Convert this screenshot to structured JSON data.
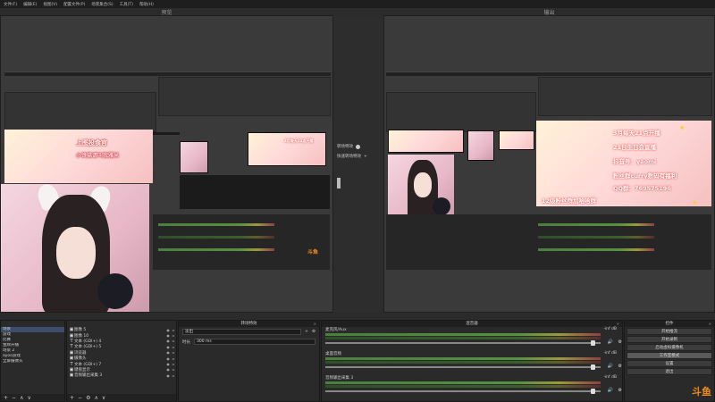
{
  "menu": [
    "文件(F)",
    "编辑(E)",
    "视图(V)",
    "配置文件(P)",
    "场景集合(S)",
    "工具(T)",
    "帮助(H)"
  ],
  "preview_title": "预览",
  "program_title": "输出",
  "transition": {
    "label1": "转场特效",
    "label2": "快速转场特效"
  },
  "overlay": {
    "preview_banner": "上图投食官",
    "preview_sub": "小馋猫请叫我雅米",
    "lines": [
      "3月每天21点开播",
      "21日生日会直播",
      "抖音号：yaomi",
      "粉丝群curry数码有福利",
      "QQ群：769575196",
      "12级粉丝群加哈哈群"
    ]
  },
  "docks": {
    "scenes_title": "场景",
    "scenes": [
      "场景",
      "游戏",
      "比赛",
      "金牌开播",
      "场景 2",
      "ayoo游戏",
      "全屏摄像头"
    ],
    "sources_title": "来源",
    "sources": [
      {
        "icon": "▣",
        "name": "图像 5"
      },
      {
        "icon": "▣",
        "name": "图像 10"
      },
      {
        "icon": "T",
        "name": "文本 (GDI+) 4"
      },
      {
        "icon": "T",
        "name": "文本 (GDI+) 5"
      },
      {
        "icon": "▣",
        "name": "浏览器"
      },
      {
        "icon": "▣",
        "name": "摄像头"
      },
      {
        "icon": "T",
        "name": "文本 (GDI+) 7"
      },
      {
        "icon": "▣",
        "name": "键盘显示"
      },
      {
        "icon": "▣",
        "name": "音频输出采集 3"
      }
    ],
    "props_title": "转场特效",
    "props_select": "淡出",
    "props_duration_label": "时长",
    "props_duration_value": "300 ms",
    "mixer_title": "混音器",
    "mixer": [
      {
        "name": "麦克风/Aux",
        "db": "-inf dB"
      },
      {
        "name": "桌面音频",
        "db": "-inf dB"
      },
      {
        "name": "音频输出采集 3",
        "db": "-inf dB"
      }
    ],
    "controls_title": "控件",
    "controls": [
      "开始推流",
      "开始录制",
      "启动虚拟摄像机",
      "工作室模式",
      "设置",
      "退出"
    ]
  },
  "watermark": "斗鱼",
  "watermark_small": "斗鱼",
  "toolbar_glyphs": [
    "+",
    "−",
    "∧",
    "∨"
  ],
  "colors": {
    "accent": "#f28b1e",
    "meter_green": "#56913f",
    "selected": "#3d4d6a"
  }
}
